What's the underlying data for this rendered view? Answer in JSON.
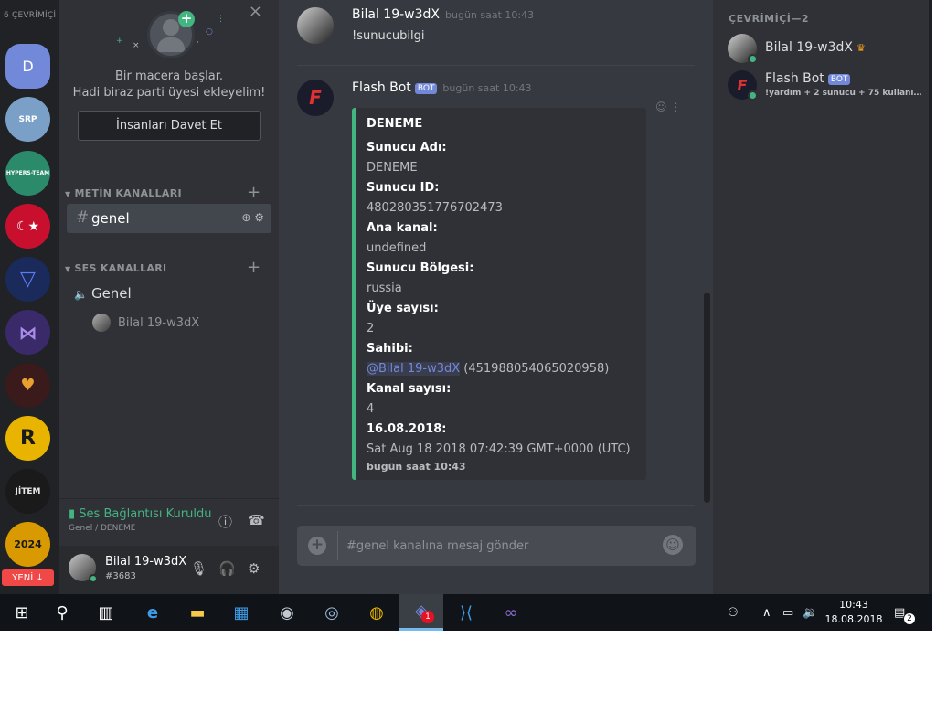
{
  "guilds": {
    "online_count": "6 ÇEVRİMİÇİ",
    "dm_label": "D",
    "servers": [
      {
        "name": "SRP",
        "color": "#7aa0c8",
        "text": "SRP"
      },
      {
        "name": "HYPERS-TEAM",
        "color": "#2a8a6a",
        "text": "HYPERS-TEAM"
      },
      {
        "name": "Turkey",
        "color": "#c8102e",
        "text": "☾★"
      },
      {
        "name": "V",
        "color": "#1a2a5a",
        "text": "▽"
      },
      {
        "name": "Butterfly",
        "color": "#3a2a6a",
        "text": "⋈"
      },
      {
        "name": "Heart",
        "color": "#3a1a1a",
        "text": "♥"
      },
      {
        "name": "R",
        "color": "#e8b400",
        "text": "R"
      },
      {
        "name": "JITEM",
        "color": "#1a1a1a",
        "text": "JİTEM"
      },
      {
        "name": "2024 studio",
        "color": "#d89a00",
        "text": "2024"
      }
    ],
    "new_badge": "YENİ ↓"
  },
  "invite": {
    "line1": "Bir macera başlar.",
    "line2": "Hadi biraz parti üyesi ekleyelim!",
    "button": "İnsanları Davet Et"
  },
  "channels": {
    "text_category": "METİN KANALLARI",
    "active_channel": "genel",
    "voice_category": "SES KANALLARI",
    "voice_channel": "Genel",
    "voice_user": "Bilal 19-w3dX"
  },
  "voice_panel": {
    "status": "Ses Bağlantısı Kuruldu",
    "sub": "Genel / DENEME"
  },
  "user_panel": {
    "name": "Bilal 19-w3dX",
    "tag": "#3683"
  },
  "messages": [
    {
      "author": "Bilal 19-w3dX",
      "time": "bugün saat 10:43",
      "text": "!sunucubilgi"
    },
    {
      "author": "Flash Bot",
      "bot_tag": "BOT",
      "time": "bugün saat 10:43"
    }
  ],
  "embed": {
    "title": "DENEME",
    "fields": [
      {
        "name": "Sunucu Adı:",
        "value": "DENEME"
      },
      {
        "name": "Sunucu ID:",
        "value": "480280351776702473"
      },
      {
        "name": "Ana kanal:",
        "value": "undefined"
      },
      {
        "name": "Sunucu Bölgesi:",
        "value": "russia"
      },
      {
        "name": "Üye sayısı:",
        "value": "2"
      },
      {
        "name": "Sahibi:",
        "mention": "@Bilal 19-w3dX",
        "value": "(451988054065020958)"
      },
      {
        "name": "Kanal sayısı:",
        "value": "4"
      },
      {
        "name": "16.08.2018:",
        "value": "Sat Aug 18 2018 07:42:39 GMT+0000 (UTC)"
      }
    ],
    "footer": "bugün saat 10:43",
    "accent": "#43b581"
  },
  "input": {
    "placeholder": "#genel kanalına mesaj gönder"
  },
  "members": {
    "header": "ÇEVRİMİÇİ—2",
    "list": [
      {
        "name": "Bilal 19-w3dX",
        "owner": true
      },
      {
        "name": "Flash Bot",
        "bot_tag": "BOT",
        "status": "!yardım + 2 sunucu + 75 kullanıcı O..."
      }
    ]
  },
  "taskbar": {
    "time": "10:43",
    "date": "18.08.2018",
    "discord_badge": "1",
    "notifications": "2"
  }
}
